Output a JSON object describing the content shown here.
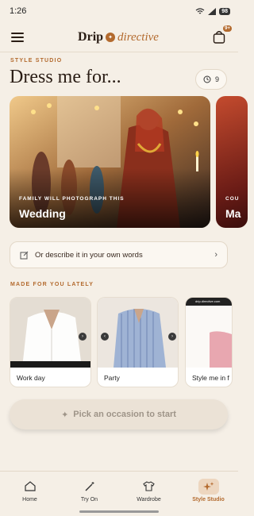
{
  "status": {
    "time": "1:26",
    "battery": "98"
  },
  "brand": {
    "name_primary": "Drip",
    "name_secondary": "directive",
    "bag_badge": "9+"
  },
  "header": {
    "eyebrow": "STYLE STUDIO",
    "title": "Dress me for...",
    "history_count": "9"
  },
  "carousel": [
    {
      "subtitle": "FAMILY WILL PHOTOGRAPH THIS",
      "title": "Wedding"
    },
    {
      "subtitle": "COU",
      "title": "Ma"
    }
  ],
  "describe": {
    "label": "Or describe it in your own words"
  },
  "made_for_you": {
    "heading": "MADE FOR YOU LATELY",
    "items": [
      {
        "label": "Work day"
      },
      {
        "label": "Party"
      },
      {
        "label": "Style me in f"
      }
    ],
    "third_url": "drip.directive.com"
  },
  "cta": {
    "label": "Pick an occasion to start"
  },
  "tabs": [
    {
      "label": "Home",
      "icon": "home-icon"
    },
    {
      "label": "Try On",
      "icon": "magic-wand-icon"
    },
    {
      "label": "Wardrobe",
      "icon": "shirt-icon"
    },
    {
      "label": "Style Studio",
      "icon": "sparkle-icon",
      "active": true
    }
  ],
  "colors": {
    "accent": "#b36a2e",
    "background": "#f5efe6"
  }
}
